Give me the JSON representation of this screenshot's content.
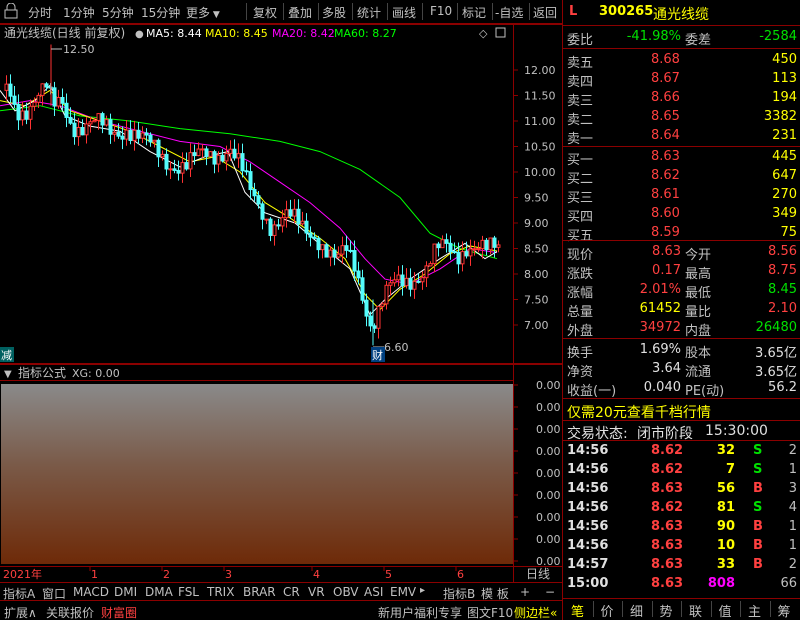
{
  "toolbar": {
    "items": [
      "分时",
      "1分钟",
      "5分钟",
      "15分钟",
      "更多",
      "复权",
      "叠加",
      "多股",
      "统计",
      "画线",
      "F10",
      "标记",
      "-自选",
      "返回"
    ]
  },
  "main_chart": {
    "title": "通光线缆(日线 前复权)",
    "ma5_label": "MA5: 8.44",
    "ma10_label": "MA10: 8.45",
    "ma20_label": "MA20: 8.42",
    "ma60_label": "MA60: 8.27",
    "high_marker": "12.50",
    "low_marker": "6.60",
    "left_tag": "减",
    "finance_tag": "财",
    "y_ticks": [
      "12.00",
      "11.50",
      "11.00",
      "10.50",
      "10.00",
      "9.50",
      "9.00",
      "8.50",
      "8.00",
      "7.50",
      "7.00"
    ],
    "colors": {
      "ma5": "#ffffff",
      "ma10": "#ffff00",
      "ma20": "#ff00ff",
      "ma60": "#00ff00",
      "up": "#ff3232",
      "down": "#54fcfc"
    }
  },
  "indicator": {
    "title": "指标公式",
    "xg_label": "XG: 0.00",
    "y_ticks": [
      "0.00",
      "0.00",
      "0.00",
      "0.00",
      "0.00",
      "0.00",
      "0.00",
      "0.00",
      "0.00"
    ]
  },
  "time_axis": {
    "year_label": "2021年",
    "months": [
      "1",
      "2",
      "3",
      "4",
      "5",
      "6"
    ],
    "period": "日线"
  },
  "ind_tabs": {
    "items": [
      "指标A",
      "窗口",
      "MACD",
      "DMI",
      "DMA",
      "FSL",
      "TRIX",
      "BRAR",
      "CR",
      "VR",
      "OBV",
      "ASI",
      "EMV"
    ],
    "right_items": [
      "指标B",
      "模 板",
      "+",
      "−"
    ]
  },
  "status": {
    "expand": "扩展∧",
    "related": "关联报价",
    "wealth": "财富圈",
    "promo": "新用户福利专享",
    "f10": "图文F10",
    "sidebar": "侧边栏«"
  },
  "quote": {
    "market_tag": "L",
    "code": "300265",
    "name": "通光线缆",
    "webi_label": "委比",
    "webi_value": "-41.98%",
    "weicha_label": "委差",
    "weicha_value": "-2584",
    "sell": [
      {
        "label": "卖五",
        "price": "8.68",
        "vol": "450"
      },
      {
        "label": "卖四",
        "price": "8.67",
        "vol": "113"
      },
      {
        "label": "卖三",
        "price": "8.66",
        "vol": "194"
      },
      {
        "label": "卖二",
        "price": "8.65",
        "vol": "3382"
      },
      {
        "label": "卖一",
        "price": "8.64",
        "vol": "231"
      }
    ],
    "buy": [
      {
        "label": "买一",
        "price": "8.63",
        "vol": "445"
      },
      {
        "label": "买二",
        "price": "8.62",
        "vol": "647"
      },
      {
        "label": "买三",
        "price": "8.61",
        "vol": "270"
      },
      {
        "label": "买四",
        "price": "8.60",
        "vol": "349"
      },
      {
        "label": "买五",
        "price": "8.59",
        "vol": "75"
      }
    ],
    "stats": [
      {
        "l1": "现价",
        "v1": "8.63",
        "c1": "red",
        "l2": "今开",
        "v2": "8.56",
        "c2": "red"
      },
      {
        "l1": "涨跌",
        "v1": "0.17",
        "c1": "red",
        "l2": "最高",
        "v2": "8.75",
        "c2": "red"
      },
      {
        "l1": "涨幅",
        "v1": "2.01%",
        "c1": "red",
        "l2": "最低",
        "v2": "8.45",
        "c2": "green"
      },
      {
        "l1": "总量",
        "v1": "61452",
        "c1": "yellow",
        "l2": "量比",
        "v2": "2.10",
        "c2": "red"
      },
      {
        "l1": "外盘",
        "v1": "34972",
        "c1": "red",
        "l2": "内盘",
        "v2": "26480",
        "c2": "green"
      }
    ],
    "stats2": [
      {
        "l1": "换手",
        "v1": "1.69%",
        "l2": "股本",
        "v2": "3.65亿"
      },
      {
        "l1": "净资",
        "v1": "3.64",
        "l2": "流通",
        "v2": "3.65亿"
      },
      {
        "l1": "收益(一)",
        "v1": "0.040",
        "l2": "PE(动)",
        "v2": "56.2"
      }
    ],
    "promo": "仅需20元查看千档行情",
    "trade_status_label": "交易状态:",
    "trade_status": "闭市阶段",
    "trade_time": "15:30:00",
    "ticks": [
      {
        "t": "14:56",
        "p": "8.62",
        "v": "32",
        "bs": "S",
        "n": "2",
        "pc": "red",
        "vc": "yellow",
        "bc": "green"
      },
      {
        "t": "14:56",
        "p": "8.62",
        "v": "7",
        "bs": "S",
        "n": "1",
        "pc": "red",
        "vc": "yellow",
        "bc": "green"
      },
      {
        "t": "14:56",
        "p": "8.63",
        "v": "56",
        "bs": "B",
        "n": "3",
        "pc": "red",
        "vc": "yellow",
        "bc": "red"
      },
      {
        "t": "14:56",
        "p": "8.62",
        "v": "81",
        "bs": "S",
        "n": "4",
        "pc": "red",
        "vc": "yellow",
        "bc": "green"
      },
      {
        "t": "14:56",
        "p": "8.63",
        "v": "90",
        "bs": "B",
        "n": "1",
        "pc": "red",
        "vc": "yellow",
        "bc": "red"
      },
      {
        "t": "14:56",
        "p": "8.63",
        "v": "10",
        "bs": "B",
        "n": "1",
        "pc": "red",
        "vc": "yellow",
        "bc": "red"
      },
      {
        "t": "14:57",
        "p": "8.63",
        "v": "33",
        "bs": "B",
        "n": "2",
        "pc": "red",
        "vc": "yellow",
        "bc": "red"
      },
      {
        "t": "15:00",
        "p": "8.63",
        "v": "808",
        "bs": "",
        "n": "66",
        "pc": "red",
        "vc": "magenta",
        "bc": "red"
      }
    ],
    "bottom_tabs": [
      "笔",
      "价",
      "细",
      "势",
      "联",
      "值",
      "主",
      "筹"
    ]
  }
}
